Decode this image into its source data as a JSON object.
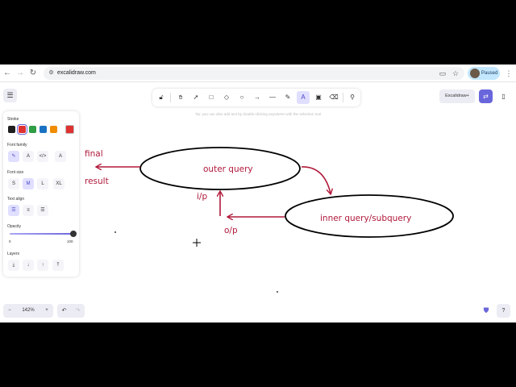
{
  "browser": {
    "url": "excalidraw.com",
    "profile_status": "Paused"
  },
  "toolbar": {
    "hint": "Tip: you can also add text by double-clicking anywhere with the selection tool",
    "library_label": "Excalidraw+"
  },
  "properties": {
    "stroke_label": "Stroke",
    "stroke_colors": [
      "#1e1e1e",
      "#e03131",
      "#2f9e44",
      "#1971c2",
      "#f08c00"
    ],
    "current_stroke": "#e03131",
    "font_family_label": "Font family",
    "font_size_label": "Font size",
    "font_sizes": [
      "S",
      "M",
      "L",
      "XL"
    ],
    "text_align_label": "Text align",
    "opacity_label": "Opacity",
    "opacity_min": "0",
    "opacity_max": "100",
    "layers_label": "Layers"
  },
  "zoom": {
    "level": "142%",
    "minus": "−",
    "plus": "+"
  },
  "drawing": {
    "outer_query": "outer query",
    "inner_query": "inner query/subquery",
    "final": "final",
    "result": "result",
    "input_label": "i/p",
    "output_label": "o/p"
  }
}
